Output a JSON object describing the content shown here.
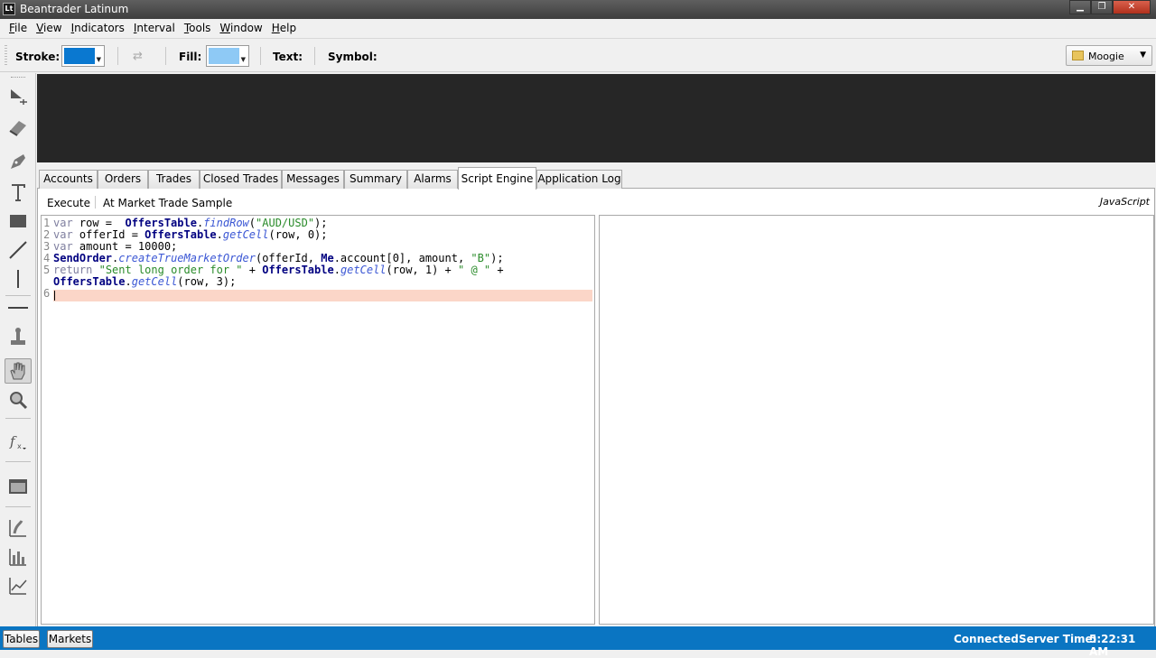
{
  "window": {
    "title": "Beantrader Latinum",
    "app_icon_text": "Lt",
    "minimize": "▁",
    "maximize": "❐",
    "close": "✕"
  },
  "menu": [
    {
      "first": "F",
      "rest": "ile"
    },
    {
      "first": "V",
      "rest": "iew"
    },
    {
      "first": "I",
      "rest": "ndicators"
    },
    {
      "first": "I",
      "rest": "nterval"
    },
    {
      "first": "T",
      "rest": "ools"
    },
    {
      "first": "W",
      "rest": "indow"
    },
    {
      "first": "H",
      "rest": "elp"
    }
  ],
  "toolbar": {
    "stroke_label": "Stroke:",
    "stroke_color": "#0a78d0",
    "fill_label": "Fill:",
    "fill_color": "#8ec9f5",
    "text_label": "Text:",
    "symbol_label": "Symbol:",
    "profile": "Moogie"
  },
  "tabs": [
    "Accounts",
    "Orders",
    "Trades",
    "Closed Trades",
    "Messages",
    "Summary",
    "Alarms",
    "Script Engine",
    "Application Log"
  ],
  "active_tab": "Script Engine",
  "script": {
    "execute_label": "Execute",
    "sample_label": "At Market Trade Sample",
    "language": "JavaScript",
    "line_numbers": [
      "1",
      "2",
      "3",
      "4",
      "5",
      "",
      "6"
    ]
  },
  "statusbar": {
    "tables_label": "Tables",
    "markets_label": "Markets",
    "connection": "Connected",
    "server_time_label": "Server Time:",
    "server_time": "5:22:31 AM"
  },
  "colors": {
    "statusbar": "#0a75c2",
    "chart_bg": "#262626",
    "current_line": "#fbd6c8"
  }
}
